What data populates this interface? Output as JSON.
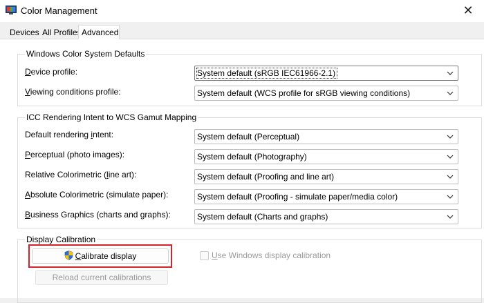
{
  "window": {
    "title": "Color Management",
    "close_glyph": "✕"
  },
  "tabs": [
    {
      "label": "Devices",
      "selected": false
    },
    {
      "label": "All Profiles",
      "selected": false
    },
    {
      "label": "Advanced",
      "selected": true
    }
  ],
  "wcs_defaults": {
    "legend": "Windows Color System Defaults",
    "device_profile": {
      "label_accel": "D",
      "label_rest": "evice profile:",
      "value": "System default (sRGB IEC61966-2.1)"
    },
    "viewing_conditions": {
      "label_accel": "V",
      "label_rest": "iewing conditions profile:",
      "value": "System default (WCS profile for sRGB viewing conditions)"
    }
  },
  "icc_mapping": {
    "legend": "ICC Rendering Intent to WCS Gamut Mapping",
    "rows": [
      {
        "label_pre": "Default rendering ",
        "label_accel": "i",
        "label_post": "ntent:",
        "value": "System default (Perceptual)"
      },
      {
        "label_pre": "",
        "label_accel": "P",
        "label_post": "erceptual (photo images):",
        "value": "System default (Photography)"
      },
      {
        "label_pre": "Relative Colorimetric (",
        "label_accel": "l",
        "label_post": "ine art):",
        "value": "System default (Proofing and line art)"
      },
      {
        "label_pre": "",
        "label_accel": "A",
        "label_post": "bsolute Colorimetric (simulate paper):",
        "value": "System default (Proofing - simulate paper/media color)"
      },
      {
        "label_pre": "",
        "label_accel": "B",
        "label_post": "usiness Graphics (charts and graphs):",
        "value": "System default (Charts and graphs)"
      }
    ]
  },
  "display_calibration": {
    "legend": "Display Calibration",
    "calibrate_accel": "C",
    "calibrate_rest": "alibrate display",
    "use_windows_accel": "U",
    "use_windows_rest": "se Windows display calibration",
    "use_windows_checked": false,
    "reload_label": "Reload current calibrations"
  },
  "icons": {
    "app": "color-management-monitor-icon",
    "shield": "uac-shield-icon",
    "chevron": "chevron-down-icon"
  },
  "colors": {
    "highlight": "#d2232a",
    "shield_blue": "#2f6fc9",
    "shield_yellow": "#f2c316"
  }
}
